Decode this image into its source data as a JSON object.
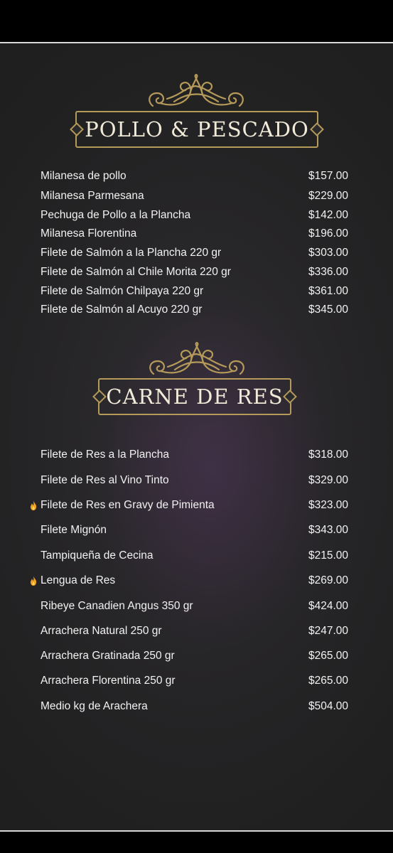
{
  "colors": {
    "background": "#252426",
    "gold": "#b59a5a",
    "text": "#f2f2f2",
    "flame": "#f0a020"
  },
  "sections": [
    {
      "title": "POLLO & PESCADO",
      "items": [
        {
          "name": "Milanesa de pollo",
          "price": "$157.00"
        },
        {
          "name": "Milanesa Parmesana",
          "price": "$229.00"
        },
        {
          "name": "Pechuga de Pollo a la Plancha",
          "price": "$142.00"
        },
        {
          "name": "Milanesa Florentina",
          "price": "$196.00"
        },
        {
          "name": "Filete de Salmón a la Plancha 220 gr",
          "price": "$303.00"
        },
        {
          "name": "Filete de Salmón al Chile Morita 220 gr",
          "price": "$336.00"
        },
        {
          "name": "Filete de Salmón Chilpaya 220 gr",
          "price": "$361.00"
        },
        {
          "name": "Filete de Salmón al Acuyo 220 gr",
          "price": "$345.00"
        }
      ]
    },
    {
      "title": "CARNE DE RES",
      "items": [
        {
          "name": "Filete de Res a la Plancha",
          "price": "$318.00",
          "icon": null
        },
        {
          "name": "Filete de Res al Vino Tinto",
          "price": "$329.00",
          "icon": null
        },
        {
          "name": "Filete de Res en Gravy de Pimienta",
          "price": "$323.00",
          "icon": "flame-icon"
        },
        {
          "name": "Filete Mignón",
          "price": "$343.00",
          "icon": null
        },
        {
          "name": "Tampiqueña de Cecina",
          "price": "$215.00",
          "icon": null
        },
        {
          "name": "Lengua de Res",
          "price": "$269.00",
          "icon": "flame-icon"
        },
        {
          "name": "Ribeye Canadien Angus 350 gr",
          "price": "$424.00",
          "icon": null
        },
        {
          "name": "Arrachera Natural 250 gr",
          "price": "$247.00",
          "icon": null
        },
        {
          "name": "Arrachera Gratinada 250 gr",
          "price": "$265.00",
          "icon": null
        },
        {
          "name": "Arrachera Florentina 250 gr",
          "price": "$265.00",
          "icon": null
        },
        {
          "name": "Medio kg de Arachera",
          "price": "$504.00",
          "icon": null
        }
      ]
    }
  ]
}
